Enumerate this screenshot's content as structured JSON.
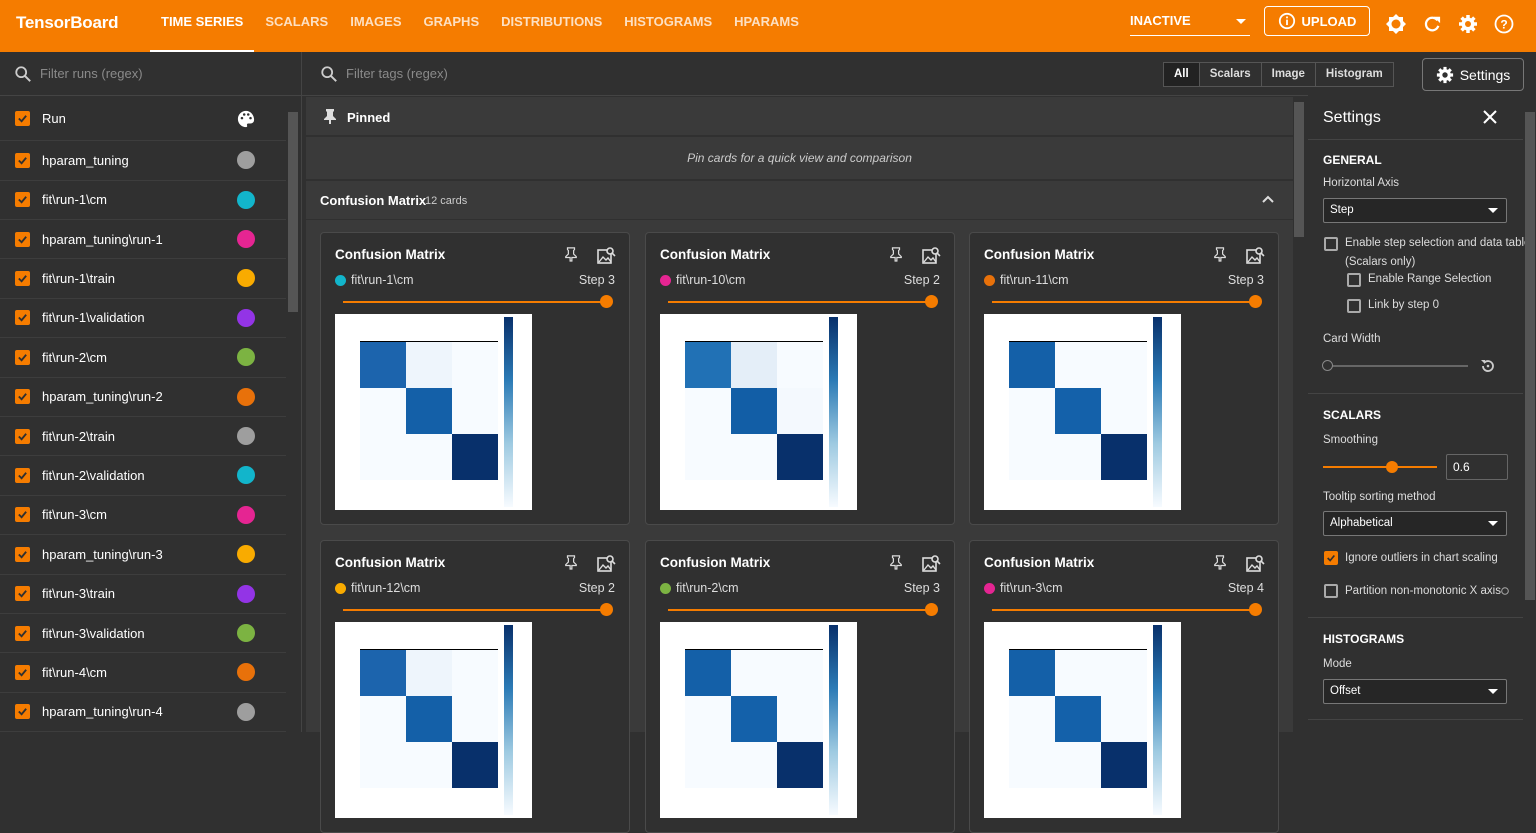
{
  "header": {
    "brand": "TensorBoard",
    "tabs": [
      "TIME SERIES",
      "SCALARS",
      "IMAGES",
      "GRAPHS",
      "DISTRIBUTIONS",
      "HISTOGRAMS",
      "HPARAMS"
    ],
    "status": "INACTIVE",
    "upload": "UPLOAD",
    "icons": [
      "brightness-icon",
      "refresh-icon",
      "gear-icon",
      "help-icon"
    ]
  },
  "runs": {
    "filter_placeholder": "Filter runs (regex)",
    "header": "Run",
    "items": [
      {
        "label": "hparam_tuning",
        "color": "#9e9e9e"
      },
      {
        "label": "fit\\run-1\\cm",
        "color": "#12b5cb"
      },
      {
        "label": "hparam_tuning\\run-1",
        "color": "#e52592"
      },
      {
        "label": "fit\\run-1\\train",
        "color": "#f9ab00"
      },
      {
        "label": "fit\\run-1\\validation",
        "color": "#9334e6"
      },
      {
        "label": "fit\\run-2\\cm",
        "color": "#7cb342"
      },
      {
        "label": "hparam_tuning\\run-2",
        "color": "#e8710a"
      },
      {
        "label": "fit\\run-2\\train",
        "color": "#9e9e9e"
      },
      {
        "label": "fit\\run-2\\validation",
        "color": "#12b5cb"
      },
      {
        "label": "fit\\run-3\\cm",
        "color": "#e52592"
      },
      {
        "label": "hparam_tuning\\run-3",
        "color": "#f9ab00"
      },
      {
        "label": "fit\\run-3\\train",
        "color": "#9334e6"
      },
      {
        "label": "fit\\run-3\\validation",
        "color": "#7cb342"
      },
      {
        "label": "fit\\run-4\\cm",
        "color": "#e8710a"
      },
      {
        "label": "hparam_tuning\\run-4",
        "color": "#9e9e9e"
      }
    ]
  },
  "main": {
    "tag_placeholder": "Filter tags (regex)",
    "filters": [
      "All",
      "Scalars",
      "Image",
      "Histogram"
    ],
    "settings_btn": "Settings",
    "pinned": {
      "title": "Pinned",
      "hint": "Pin cards for a quick view and comparison"
    },
    "group": {
      "title": "Confusion Matrix",
      "count": "12 cards"
    },
    "cards": [
      {
        "title": "Confusion Matrix",
        "run": "fit\\run-1\\cm",
        "color": "#12b5cb",
        "step": "Step 3"
      },
      {
        "title": "Confusion Matrix",
        "run": "fit\\run-10\\cm",
        "color": "#e52592",
        "step": "Step 2"
      },
      {
        "title": "Confusion Matrix",
        "run": "fit\\run-11\\cm",
        "color": "#e8710a",
        "step": "Step 3"
      },
      {
        "title": "Confusion Matrix",
        "run": "fit\\run-12\\cm",
        "color": "#f9ab00",
        "step": "Step 2"
      },
      {
        "title": "Confusion Matrix",
        "run": "fit\\run-2\\cm",
        "color": "#7cb342",
        "step": "Step 3"
      },
      {
        "title": "Confusion Matrix",
        "run": "fit\\run-3\\cm",
        "color": "#e52592",
        "step": "Step 4"
      }
    ]
  },
  "settings": {
    "title": "Settings",
    "general": "GENERAL",
    "horizontal_axis_label": "Horizontal Axis",
    "horizontal_axis": "Step",
    "step_sel": "Enable step selection and data table",
    "step_sel2": "(Scalars only)",
    "range_sel": "Enable Range Selection",
    "link_step": "Link by step 0",
    "card_width": "Card Width",
    "scalars": "SCALARS",
    "smoothing": "Smoothing",
    "smoothing_value": "0.6",
    "tooltip_label": "Tooltip sorting method",
    "tooltip": "Alphabetical",
    "ignore_outliers": "Ignore outliers in chart scaling",
    "partition": "Partition non-monotonic X axis",
    "histograms": "HISTOGRAMS",
    "mode_label": "Mode",
    "mode": "Offset"
  }
}
